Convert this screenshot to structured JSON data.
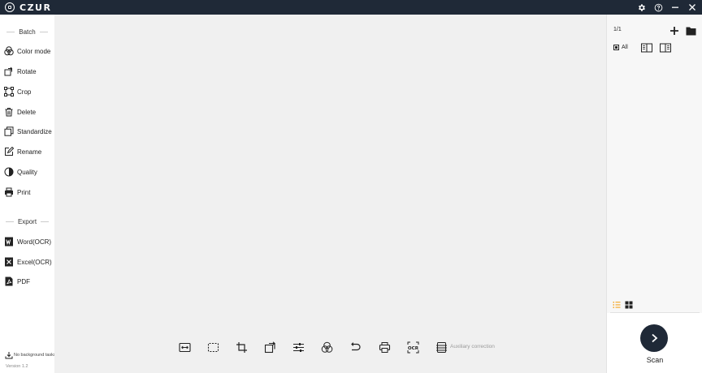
{
  "app": {
    "logo_text": "CZUR",
    "version": "Version 1.2"
  },
  "titlebar": {
    "icons": [
      "gear-icon",
      "help-icon",
      "minimize-icon",
      "close-icon"
    ]
  },
  "sidebar": {
    "batch_heading": "Batch",
    "batch_items": [
      {
        "label": "Color mode",
        "icon": "color-mode-icon"
      },
      {
        "label": "Rotate",
        "icon": "rotate-icon"
      },
      {
        "label": "Crop",
        "icon": "crop-icon"
      },
      {
        "label": "Delete",
        "icon": "trash-icon"
      },
      {
        "label": "Standardize",
        "icon": "standardize-icon"
      },
      {
        "label": "Rename",
        "icon": "rename-icon"
      },
      {
        "label": "Quality",
        "icon": "quality-icon"
      },
      {
        "label": "Print",
        "icon": "printer-icon"
      }
    ],
    "export_heading": "Export",
    "export_items": [
      {
        "label": "Word(OCR)",
        "icon": "word-icon"
      },
      {
        "label": "Excel(OCR)",
        "icon": "excel-icon"
      },
      {
        "label": "PDF",
        "icon": "pdf-icon"
      }
    ],
    "background_tasks": "No background tasks"
  },
  "toolbar": {
    "icons": [
      "fit-width-icon",
      "selection-icon",
      "crop-icon",
      "rotate-icon",
      "adjust-icon",
      "color-mode-icon",
      "undo-icon",
      "print-icon",
      "ocr-icon",
      "auxiliary-correction-icon"
    ],
    "ocr_icon_text": "OCR",
    "auxiliary_label": "Auxiliary correction"
  },
  "right_panel": {
    "page_count": "1/1",
    "all_label": "All",
    "scan_label": "Scan",
    "colors": {
      "accent": "#f5a623",
      "dark": "#1f2937"
    }
  }
}
